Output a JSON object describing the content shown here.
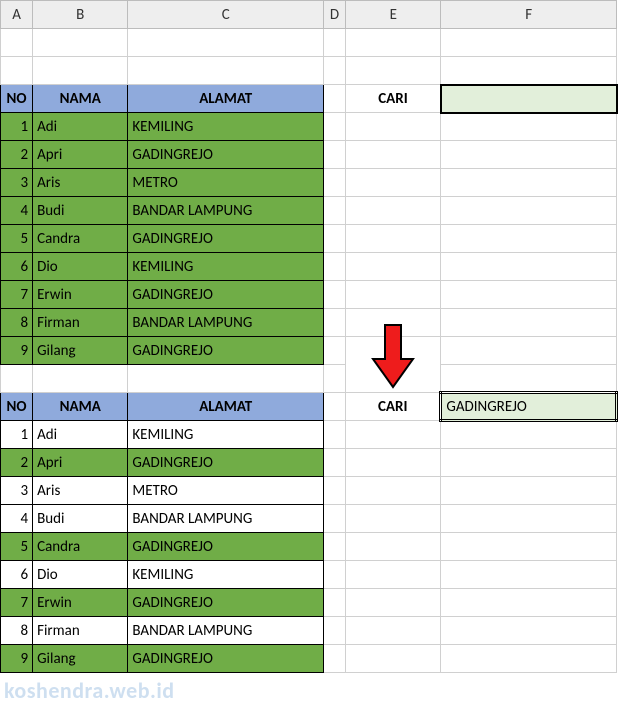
{
  "columns": {
    "A": "A",
    "B": "B",
    "C": "C",
    "D": "D",
    "E": "E",
    "F": "F"
  },
  "headers": {
    "no": "NO",
    "nama": "NAMA",
    "alamat": "ALAMAT"
  },
  "search_label": "CARI",
  "table1": {
    "search_value": "",
    "rows": [
      {
        "no": "1",
        "nama": "Adi",
        "alamat": "KEMILING"
      },
      {
        "no": "2",
        "nama": "Apri",
        "alamat": "GADINGREJO"
      },
      {
        "no": "3",
        "nama": "Aris",
        "alamat": "METRO"
      },
      {
        "no": "4",
        "nama": "Budi",
        "alamat": "BANDAR LAMPUNG"
      },
      {
        "no": "5",
        "nama": "Candra",
        "alamat": "GADINGREJO"
      },
      {
        "no": "6",
        "nama": "Dio",
        "alamat": "KEMILING"
      },
      {
        "no": "7",
        "nama": "Erwin",
        "alamat": "GADINGREJO"
      },
      {
        "no": "8",
        "nama": "Firman",
        "alamat": "BANDAR LAMPUNG"
      },
      {
        "no": "9",
        "nama": "Gilang",
        "alamat": "GADINGREJO"
      }
    ]
  },
  "table2": {
    "search_value": "GADINGREJO",
    "rows": [
      {
        "no": "1",
        "nama": "Adi",
        "alamat": "KEMILING",
        "hl": false
      },
      {
        "no": "2",
        "nama": "Apri",
        "alamat": "GADINGREJO",
        "hl": true
      },
      {
        "no": "3",
        "nama": "Aris",
        "alamat": "METRO",
        "hl": false
      },
      {
        "no": "4",
        "nama": "Budi",
        "alamat": "BANDAR LAMPUNG",
        "hl": false
      },
      {
        "no": "5",
        "nama": "Candra",
        "alamat": "GADINGREJO",
        "hl": true
      },
      {
        "no": "6",
        "nama": "Dio",
        "alamat": "KEMILING",
        "hl": false
      },
      {
        "no": "7",
        "nama": "Erwin",
        "alamat": "GADINGREJO",
        "hl": true
      },
      {
        "no": "8",
        "nama": "Firman",
        "alamat": "BANDAR LAMPUNG",
        "hl": false
      },
      {
        "no": "9",
        "nama": "Gilang",
        "alamat": "GADINGREJO",
        "hl": true
      }
    ]
  },
  "watermark": "koshendra.web.id"
}
